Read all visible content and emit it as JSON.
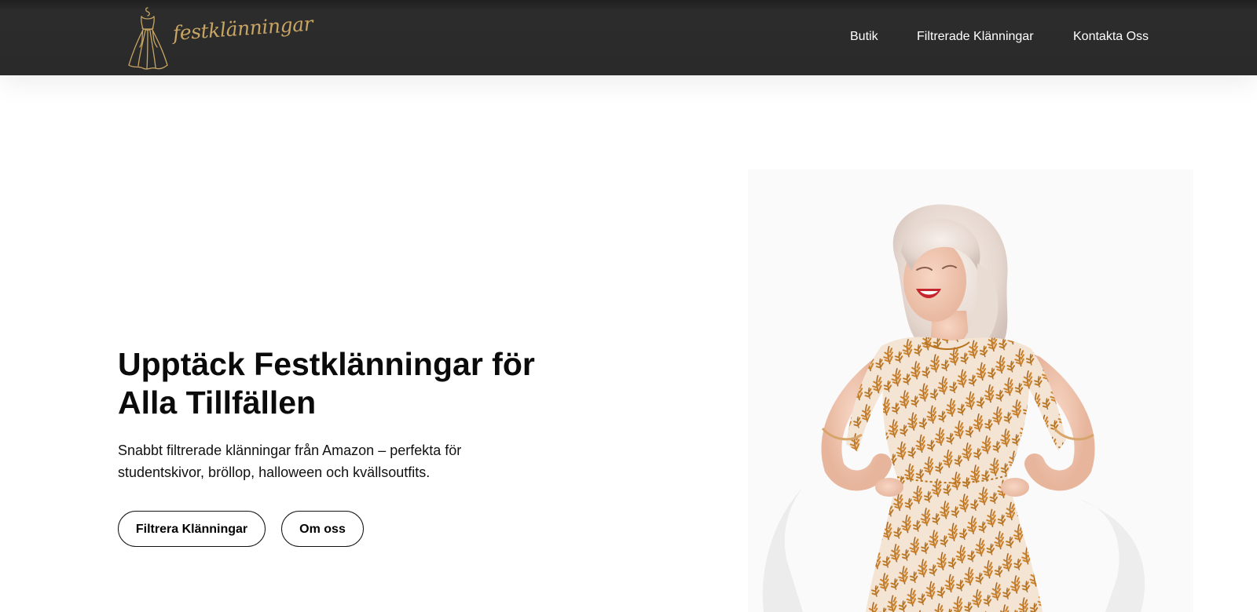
{
  "brand": {
    "logo_text": "festklänningar",
    "logo_icon": "dress-icon",
    "accent_color": "#c8a562"
  },
  "nav": {
    "items": [
      {
        "label": "Butik"
      },
      {
        "label": "Filtrerade Klänningar"
      },
      {
        "label": "Kontakta Oss"
      }
    ]
  },
  "hero": {
    "title": "Upptäck Festklänningar för Alla Tillfällen",
    "description": "Snabbt filtrerade klänningar från Amazon – perfekta för studentskivor, bröllop, halloween och kvällsoutfits.",
    "primary_button": "Filtrera Klänningar",
    "secondary_button": "Om oss",
    "image": "woman-in-patterned-dress-photo"
  },
  "colors": {
    "header_bg": "#2a2a2a",
    "text": "#0b0b0b",
    "dress_print": "#b8731d"
  }
}
